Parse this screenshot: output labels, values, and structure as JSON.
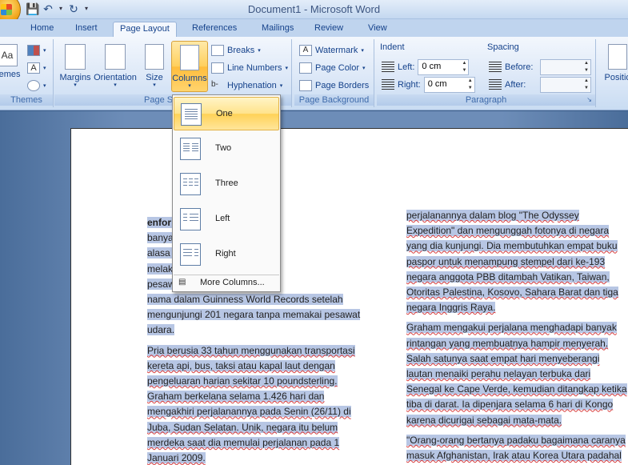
{
  "window": {
    "title": "Document1 - Microsoft Word"
  },
  "quick_access": {
    "save": "save-icon",
    "undo": "undo-icon",
    "redo": "redo-icon"
  },
  "tabs": [
    "Home",
    "Insert",
    "Page Layout",
    "References",
    "Mailings",
    "Review",
    "View"
  ],
  "active_tab": "Page Layout",
  "ribbon": {
    "themes_group": {
      "label": "Themes",
      "button": "hemes"
    },
    "page_setup": {
      "label": "Page S",
      "margins": "Margins",
      "orientation": "Orientation",
      "size": "Size",
      "columns": "Columns",
      "breaks": "Breaks",
      "line_numbers": "Line Numbers",
      "hyphenation": "Hyphenation"
    },
    "page_background": {
      "label": "Page Background",
      "watermark": "Watermark",
      "page_color": "Page Color",
      "page_borders": "Page Borders"
    },
    "paragraph": {
      "label": "Paragraph",
      "indent_label": "Indent",
      "left_label": "Left:",
      "left_value": "0 cm",
      "right_label": "Right:",
      "right_value": "0 cm",
      "spacing_label": "Spacing",
      "before_label": "Before:",
      "before_value": "",
      "after_label": "After:",
      "after_value": ""
    },
    "arrange": {
      "position": "Positio"
    }
  },
  "columns_menu": {
    "items": [
      "One",
      "Two",
      "Three",
      "Left",
      "Right"
    ],
    "highlighted": "One",
    "more": "More Columns..."
  },
  "document": {
    "left_col_p1_lines": [
      "enfor         mia bisa dilakukan",
      "banya        ggunakan pesawat",
      "alasa        seorang pria yang",
      "melak        pun menggunakan",
      "pesaw        ughes mencatatkan",
      "nama dalam Guinness World Records setelah",
      "mengunjungi 201 negara tanpa memakai pesawat",
      "udara."
    ],
    "left_col_p2_lines": [
      "Pria berusia 33 tahun menggunakan transportasi",
      "kereta api, bus, taksi atau kapal laut dengan",
      "pengeluaran harian sekitar 10 poundsterling.",
      "Graham berkelana selama 1.426 hari dan",
      "mengakhiri perjalanannya pada Senin (26/11) di",
      "Juba, Sudan Selatan. Unik, negara itu belum",
      "merdeka saat dia memulai perjalanan pada 1",
      "Januari 2009."
    ],
    "right_col_p1_lines": [
      "perjalanannya dalam blog \"The Odyssey",
      "Expedition\" dan mengunggah fotonya di negara",
      "yang dia kunjungi. Dia membutuhkan empat buku",
      "paspor untuk menampung stempel dari ke-193",
      "negara anggota PBB ditambah Vatikan, Taiwan,",
      "Otoritas Palestina, Kosovo, Sahara Barat dan tiga",
      "negara Inggris Raya."
    ],
    "right_col_p2_lines": [
      "Graham mengakui perjalana menghadapi banyak",
      "rintangan yang membuatnya hampir menyerah.",
      "Salah satunya saat empat hari menyeberangi",
      "lautan menaiki perahu nelayan terbuka dari",
      "Senegal ke Cape Verde, kemudian ditangkap ketika",
      "tiba di darat. Ia dipenjara selama 6 hari di Kongo",
      "karena dicurigai sebagai mata-mata."
    ],
    "right_col_p3_lines": [
      "\"Orang-orang bertanya padaku bagaimana caranya",
      "masuk Afghanistan, Irak atau Korea Utara padahal"
    ]
  },
  "colors": {
    "selection": "#b7c6e4",
    "ribbon_bg": "#dbe7f7",
    "menu_highlight": "#ffd257"
  }
}
